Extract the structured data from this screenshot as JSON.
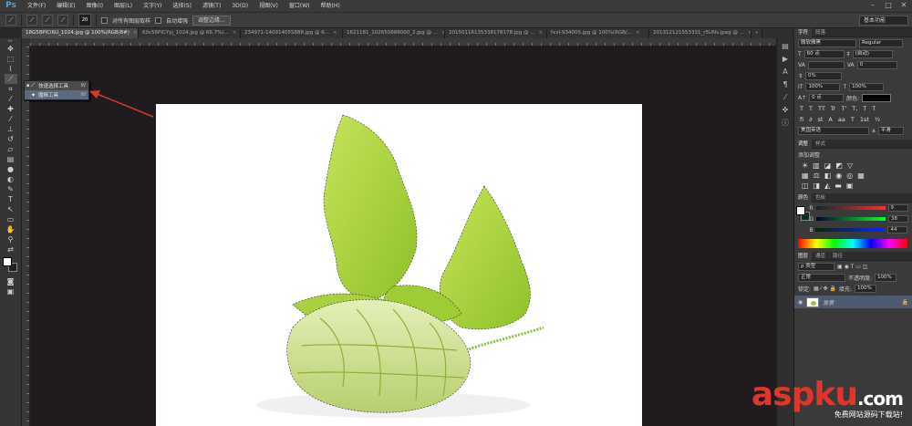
{
  "app": {
    "logo": "Ps"
  },
  "menu": [
    "文件(F)",
    "编辑(E)",
    "图像(I)",
    "图层(L)",
    "文字(Y)",
    "选择(S)",
    "滤镜(T)",
    "3D(D)",
    "视图(V)",
    "窗口(W)",
    "帮助(H)"
  ],
  "window_controls": [
    "–",
    "□",
    "✕"
  ],
  "options": {
    "brush_size": "20",
    "sample_all_layers": "对所有图层取样",
    "auto_enhance": "自动增强",
    "refine_edge": "调整边缘...",
    "workspace": "基本功能"
  },
  "tabs": [
    {
      "label": "18G58PICi6U_1024.jpg @ 100%(RGB/8#)",
      "active": true
    },
    {
      "label": "60c58PICYyj_1024.jpg @ 66.7%(...",
      "active": false
    },
    {
      "label": "234971-14091405S888.jpg @ 6...",
      "active": false
    },
    {
      "label": "1621181_102650888000_2.jpg @ ...",
      "active": false
    },
    {
      "label": "20150116135338178178.jpg @ ...",
      "active": false
    },
    {
      "label": "fxxl-934005.jpg @ 100%(RGB/...",
      "active": false
    },
    {
      "label": "201312121553331_r5UNv.jpeg @ ...",
      "active": false
    }
  ],
  "tab_overflow": "»",
  "flyout": {
    "items": [
      {
        "label": "快速选择工具",
        "shortcut": "W",
        "selected": false,
        "icon": "quick-selection-icon"
      },
      {
        "label": "魔棒工具",
        "shortcut": "W",
        "selected": true,
        "icon": "magic-wand-icon"
      }
    ]
  },
  "character_panel": {
    "tabs": [
      "字符",
      "段落"
    ],
    "font_family": "微软雅黑",
    "font_style": "Regular",
    "font_size": "60 点",
    "leading": "(自动)",
    "kerning": "VA",
    "tracking": "0",
    "scale_percent": "0%",
    "vertical_scale": "100%",
    "horizontal_scale": "100%",
    "baseline": "0 点",
    "color_label": "颜色:",
    "glyphs": [
      "T",
      "T",
      "TT",
      "Tr",
      "T'",
      "T,",
      "T",
      "T"
    ],
    "glyphs2": [
      "fi",
      "∂",
      "st",
      "A",
      "aa",
      "T",
      "1st",
      "½"
    ],
    "language": "美国英语",
    "aa_label": "a",
    "aa_value": "平滑"
  },
  "adjustments_panel": {
    "tabs": [
      "调整",
      "样式"
    ],
    "title": "添加调整"
  },
  "color_panel": {
    "tabs": [
      "颜色",
      "色板"
    ],
    "r_label": "R",
    "r_value": "9",
    "g_label": "G",
    "g_value": "38",
    "b_label": "B",
    "b_value": "44"
  },
  "layers_panel": {
    "tabs": [
      "图层",
      "通道",
      "路径"
    ],
    "filter": "ρ 类型",
    "blend_mode": "正常",
    "opacity_label": "不透明度:",
    "opacity": "100%",
    "lock_label": "锁定:",
    "fill_label": "填充:",
    "fill": "100%",
    "layer_name": "背景"
  },
  "watermark": {
    "text": "aspku",
    "suffix": ".com",
    "sub": "免费网站源码下载站!"
  },
  "colors": {
    "accent_arrow": "#d23a2e",
    "leaf": "#a6d13a",
    "selection_bg": "#5c6a80"
  }
}
